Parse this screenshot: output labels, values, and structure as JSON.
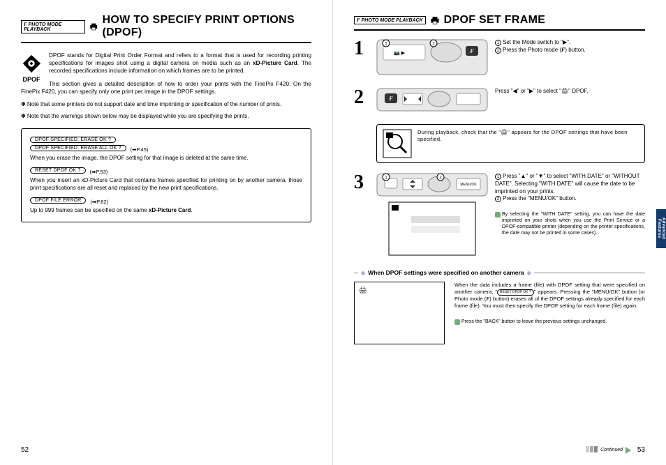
{
  "left": {
    "badge": "PHOTO MODE  PLAYBACK",
    "title": "HOW TO SPECIFY PRINT OPTIONS (DPOF)",
    "logo_text": "DPOF",
    "intro1_a": "DPOF stands for Digital Print Order Format and refers to a format that is used for recording printing specifications for images shot using a digital camera on media such as an ",
    "intro1_b": "xD-Picture Card",
    "intro1_c": ". The recorded specifications include information on which frames are to be printed.",
    "intro2": "This section gives a detailed description of how to order your prints with the FinePix F420. On the FinePix F420, you can specify only one print per image in the DPOF settings.",
    "note1": "✽ Note that some printers do not support date and time imprinting or specification of the number of prints.",
    "note2": "✽ Note that the warnings shown below may be displayed while you are specifying the prints.",
    "box": {
      "pill1": "DPOF SPECIFIED. ERASE OK ?",
      "pill2": "DPOF SPECIFIED. ERASE ALL OK ?",
      "ref1": "(➡P.45)",
      "text1": "When you erase the image, the DPOF setting for that image is deleted at the same time.",
      "pill3": "RESET DPOF OK ?",
      "ref2": "(➡P.53)",
      "text2": "When you insert an xD-Picture Card that contains frames specified for printing on by another camera, those print specifications are all reset and replaced by the new print specifications.",
      "pill4": "DPOF FILE ERROR",
      "ref3": "(➡P.82)",
      "text3_a": "Up to 999 frames can be specified on the same ",
      "text3_b": "xD-Picture Card",
      "text3_c": "."
    },
    "page_num": "52"
  },
  "right": {
    "badge": "PHOTO MODE  PLAYBACK",
    "title": "DPOF SET FRAME",
    "step1": {
      "num": "1",
      "n1": "1",
      "n2": "2",
      "t1": "Set the Mode switch to \"▶\".",
      "t2_a": "Press the Photo mode (",
      "t2_f": "F",
      "t2_b": ") button."
    },
    "step2": {
      "num": "2",
      "text": "Press \"◀\" or \"▶\" to select \"🖨\" DPOF.",
      "callout": "During playback, check that the \"🖨\" appears for the DPOF settings that have been specified."
    },
    "step3": {
      "num": "3",
      "n1": "1",
      "n2": "2",
      "t1": "Press \"▲\" or \"▼\" to select \"WITH DATE\" or \"WITHOUT DATE\". Selecting \"WITH DATE\" will cause the date to be imprinted on your prints.",
      "t2": "Press the \"MENU/OK\" button.",
      "tip": "By selecting the \"WITH DATE\" setting, you can have the date imprinted on your shots when you use the Print Service or a DPOF-compatible printer (depending on the printer specifications, the date may not be printed in some cases)."
    },
    "sub": {
      "heading": "When DPOF settings were specified on another camera",
      "text1": "When the data includes a frame (file) with DPOF setting that were specified on another camera, \"",
      "pill": "RESET DPOF OK ?",
      "text2_a": "\" appears.\nPressing the \"MENU/OK\" button (or Photo mode (",
      "text2_f": "F",
      "text2_b": ") button) erases all of the DPOF settings already specified for each frame (file). You must then specify the DPOF setting for each frame (file) again.",
      "tip": "Press the \"BACK\" button to leave the previous settings unchanged."
    },
    "side_tab_a": "Advanced",
    "side_tab_b": "Features",
    "continued": "Continued",
    "page_num": "53"
  }
}
